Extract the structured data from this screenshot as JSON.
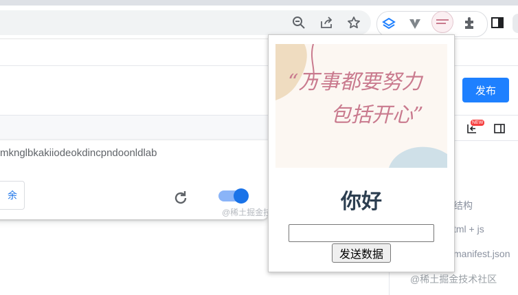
{
  "toolbar": {
    "icons": [
      "zoom-icon",
      "share-icon",
      "bookmark-star-icon"
    ],
    "extensions": [
      "layers-extension-icon",
      "v-extension-icon",
      "custom-extension-icon",
      "puzzle-extensions-icon",
      "side-panel-icon"
    ]
  },
  "page": {
    "publish_label": "发布",
    "new_badge": "NEW",
    "extension_id": "mknglbkakiiodeokdincpndoonldlab",
    "remove_label": "余",
    "watermark": "@稀土掘金技",
    "toggle_on": true,
    "sidebar_items": [
      "结构",
      "tml + js",
      "manifest.json"
    ],
    "footer_watermark": "@稀土掘金技术社区"
  },
  "popup": {
    "image_text_line1": "“万事都要努力",
    "image_text_line2": "包括开心”",
    "title": "你好",
    "input_value": "",
    "button_label": "发送数据"
  },
  "colors": {
    "accent": "#1e80ff",
    "chrome_blue": "#1a73e8",
    "popup_title": "#2c3e50"
  }
}
